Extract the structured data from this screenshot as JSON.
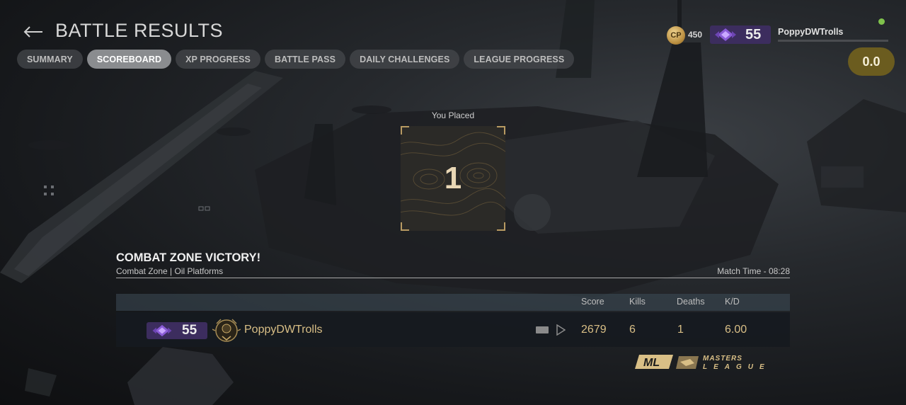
{
  "header": {
    "title": "BATTLE RESULTS",
    "back_icon": "arrow-left-icon"
  },
  "tabs": [
    {
      "label": "SUMMARY",
      "active": false
    },
    {
      "label": "SCOREBOARD",
      "active": true
    },
    {
      "label": "XP PROGRESS",
      "active": false
    },
    {
      "label": "BATTLE PASS",
      "active": false
    },
    {
      "label": "DAILY CHALLENGES",
      "active": false
    },
    {
      "label": "LEAGUE PROGRESS",
      "active": false
    }
  ],
  "player_info": {
    "cp_icon_label": "CP",
    "cp_amount": "450",
    "rank": "55",
    "username": "PoppyDWTrolls",
    "online_status_color": "#7fc24c",
    "currency_balance": "0.0"
  },
  "placement": {
    "label": "You Placed",
    "value": "1"
  },
  "match": {
    "result_title": "COMBAT ZONE VICTORY!",
    "mode_and_map": "Combat Zone | Oil Platforms",
    "match_time": "Match Time - 08:28"
  },
  "scoreboard": {
    "columns": [
      "Score",
      "Kills",
      "Deaths",
      "K/D"
    ],
    "rows": [
      {
        "rank": "55",
        "player": "PoppyDWTrolls",
        "score": "2679",
        "kills": "6",
        "deaths": "1",
        "kd": "6.00"
      }
    ]
  },
  "branding": {
    "logo_mark": "ML",
    "logo_text_line1": "MASTERS",
    "logo_text_line2": "LEAGUE"
  },
  "colors": {
    "accent_gold": "#d9bf86",
    "rank_badge": "#3c2d5e",
    "currency_pill": "#6b5c1f",
    "active_tab": "#8a8c8f"
  }
}
